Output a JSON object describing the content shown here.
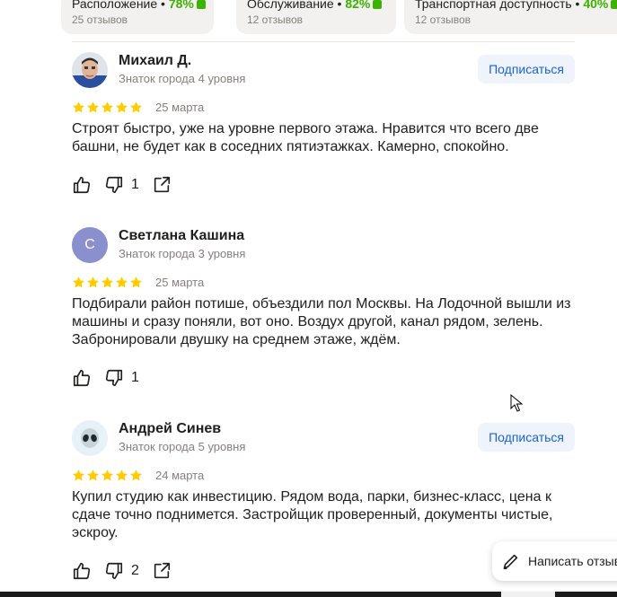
{
  "aspects": [
    {
      "title": "Расположение",
      "percent": "78%",
      "count": "25 отзывов"
    },
    {
      "title": "Обслуживание",
      "percent": "82%",
      "count": "12 отзывов"
    },
    {
      "title": "Транспортная доступность",
      "percent": "40%",
      "count": "12 отзывов"
    }
  ],
  "subscribe_label": "Подписаться",
  "reviews": [
    {
      "name": "Михаил Д.",
      "level": "Знаток города 4 уровня",
      "rating": 5,
      "date": "25 марта",
      "text": "Строят быстро, уже на уровне первого этажа. Нравится что всего две башни, не будет как в соседних пятиэтажках. Камерно, спокойно.",
      "dislikes": "1",
      "avatar_initial": ""
    },
    {
      "name": "Светлана Кашина",
      "level": "Знаток города 3 уровня",
      "rating": 5,
      "date": "25 марта",
      "text": "Подбирали район потише, объездили пол Москвы. На Лодочной вышли из машины и сразу поняли, вот оно. Воздух другой, канал рядом, зелень. Забронировали двушку на среднем этаже, ждём.",
      "dislikes": "1",
      "avatar_initial": "С"
    },
    {
      "name": "Андрей Синев",
      "level": "Знаток города 5 уровня",
      "rating": 5,
      "date": "24 марта",
      "text": "Купил студию как инвестицию. Рядом вода, парки, бизнес-класс, цена к сдаче точно поднимется. Застройщик проверенный, документы чистые, эскроу.",
      "dislikes": "2",
      "avatar_initial": ""
    }
  ],
  "write_review_label": "Написать отзыв",
  "colors": {
    "star": "#fc0",
    "accent": "#1a63d6",
    "positive": "#3bb300",
    "avatar_c": "#8a8fce"
  }
}
